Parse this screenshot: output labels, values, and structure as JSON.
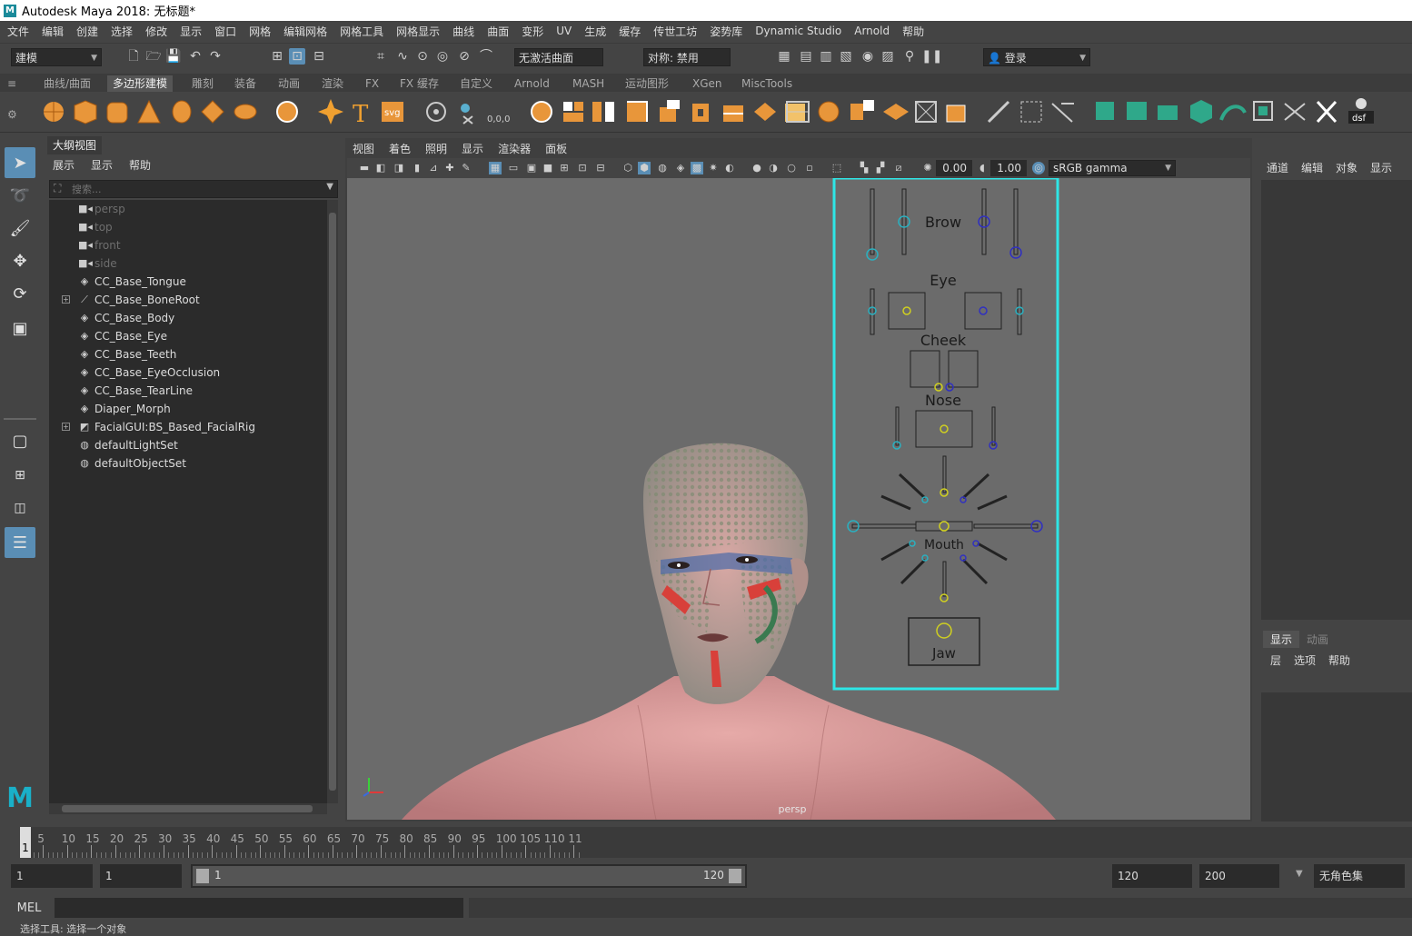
{
  "window": {
    "title": "Autodesk Maya 2018: 无标题*"
  },
  "menubar": [
    "文件",
    "编辑",
    "创建",
    "选择",
    "修改",
    "显示",
    "窗口",
    "网格",
    "编辑网格",
    "网格工具",
    "网格显示",
    "曲线",
    "曲面",
    "变形",
    "UV",
    "生成",
    "缓存",
    "传世工坊",
    "姿势库",
    "Dynamic Studio",
    "Arnold",
    "帮助"
  ],
  "statusline": {
    "mode": "建模",
    "live_surface": "无激活曲面",
    "symmetry": "对称: 禁用",
    "login": "登录"
  },
  "shelf": {
    "tabs": [
      "曲线/曲面",
      "多边形建模",
      "雕刻",
      "装备",
      "动画",
      "渲染",
      "FX",
      "FX 缓存",
      "自定义",
      "Arnold",
      "MASH",
      "运动图形",
      "XGen",
      "MiscTools"
    ],
    "active_tab": "多边形建模",
    "text_icons": {
      "type": "T",
      "svg": "svg",
      "coord": "0,0,0",
      "dsf": "dsf"
    }
  },
  "outliner": {
    "title": "大纲视图",
    "menu": [
      "展示",
      "显示",
      "帮助"
    ],
    "search_placeholder": "搜索...",
    "items": [
      {
        "label": "persp",
        "icon": "camera-icon",
        "dim": true
      },
      {
        "label": "top",
        "icon": "camera-icon",
        "dim": true
      },
      {
        "label": "front",
        "icon": "camera-icon",
        "dim": true
      },
      {
        "label": "side",
        "icon": "camera-icon",
        "dim": true
      },
      {
        "label": "CC_Base_Tongue",
        "icon": "mesh-icon"
      },
      {
        "label": "CC_Base_BoneRoot",
        "icon": "joint-icon",
        "expand": "+"
      },
      {
        "label": "CC_Base_Body",
        "icon": "mesh-icon"
      },
      {
        "label": "CC_Base_Eye",
        "icon": "mesh-icon"
      },
      {
        "label": "CC_Base_Teeth",
        "icon": "mesh-icon"
      },
      {
        "label": "CC_Base_EyeOcclusion",
        "icon": "mesh-icon"
      },
      {
        "label": "CC_Base_TearLine",
        "icon": "mesh-icon"
      },
      {
        "label": "Diaper_Morph",
        "icon": "mesh-icon"
      },
      {
        "label": "FacialGUI:BS_Based_FacialRig",
        "icon": "group-icon",
        "expand": "+"
      },
      {
        "label": "defaultLightSet",
        "icon": "set-icon"
      },
      {
        "label": "defaultObjectSet",
        "icon": "set-icon"
      }
    ]
  },
  "viewport": {
    "menu": [
      "视图",
      "着色",
      "照明",
      "显示",
      "渲染器",
      "面板"
    ],
    "exposure": "0.00",
    "gamma": "1.00",
    "colorspace": "sRGB gamma",
    "camera_label": "persp",
    "facial_gui": {
      "brow": "Brow",
      "eye": "Eye",
      "cheek": "Cheek",
      "nose": "Nose",
      "mouth": "Mouth",
      "jaw": "Jaw"
    }
  },
  "channelbox": {
    "menu": [
      "通道",
      "编辑",
      "对象",
      "显示"
    ]
  },
  "layereditor": {
    "tabs": [
      "显示",
      "动画"
    ],
    "menu": [
      "层",
      "选项",
      "帮助"
    ]
  },
  "timeslider": {
    "labels": [
      "5",
      "10",
      "15",
      "20",
      "25",
      "30",
      "35",
      "40",
      "45",
      "50",
      "55",
      "60",
      "65",
      "70",
      "75",
      "80",
      "85",
      "90",
      "95",
      "100",
      "105",
      "110",
      "11"
    ],
    "current_frame": "1"
  },
  "range": {
    "start": "1",
    "inner_start": "1",
    "slider_start": "1",
    "slider_end": "120",
    "end": "120",
    "outer_end": "200",
    "character_set": "无角色集"
  },
  "cmdline": {
    "lang": "MEL"
  },
  "helpline": {
    "text": "选择工具: 选择一个对象"
  },
  "colors": {
    "accent": "#5a8eb5",
    "gui_frame": "#2ee6e6"
  }
}
